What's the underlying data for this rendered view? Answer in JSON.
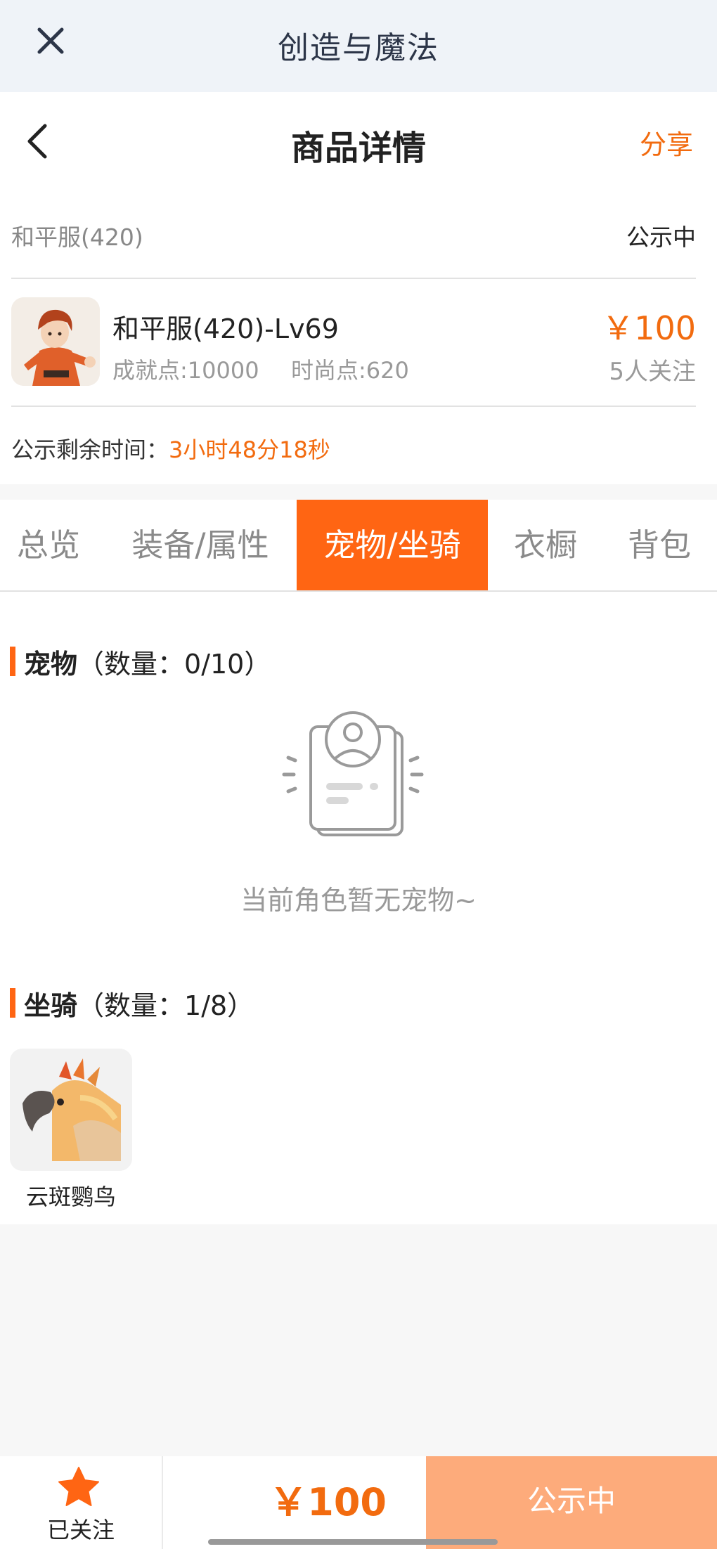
{
  "topbar": {
    "title": "创造与魔法",
    "close_icon": "close-icon"
  },
  "navbar": {
    "title": "商品详情",
    "share_label": "分享",
    "back_icon": "chevron-left-icon"
  },
  "item": {
    "server": "和平服(420)",
    "status": "公示中",
    "name": "和平服(420)-Lv69",
    "achievement": "成就点:10000",
    "fashion": "时尚点:620",
    "price": "￥100",
    "watchers": "5人关注",
    "remain_label": "公示剩余时间：",
    "remain_time": "3小时48分18秒"
  },
  "tabs": [
    {
      "label": "总览",
      "active": false
    },
    {
      "label": "装备/属性",
      "active": false
    },
    {
      "label": "宠物/坐骑",
      "active": true
    },
    {
      "label": "衣橱",
      "active": false
    },
    {
      "label": "背包",
      "active": false
    }
  ],
  "pets": {
    "title": "宠物",
    "count": "（数量：0/10）",
    "empty_text": "当前角色暂无宠物~"
  },
  "mounts": {
    "title": "坐骑",
    "count": "（数量：1/8）",
    "items": [
      {
        "name": "云斑鹦鸟"
      }
    ]
  },
  "footer": {
    "follow_label": "已关注",
    "price": "￥100",
    "status_button": "公示中"
  },
  "colors": {
    "accent": "#ff6513",
    "price": "#f26b0f",
    "button_disabled": "#fdab7b"
  }
}
